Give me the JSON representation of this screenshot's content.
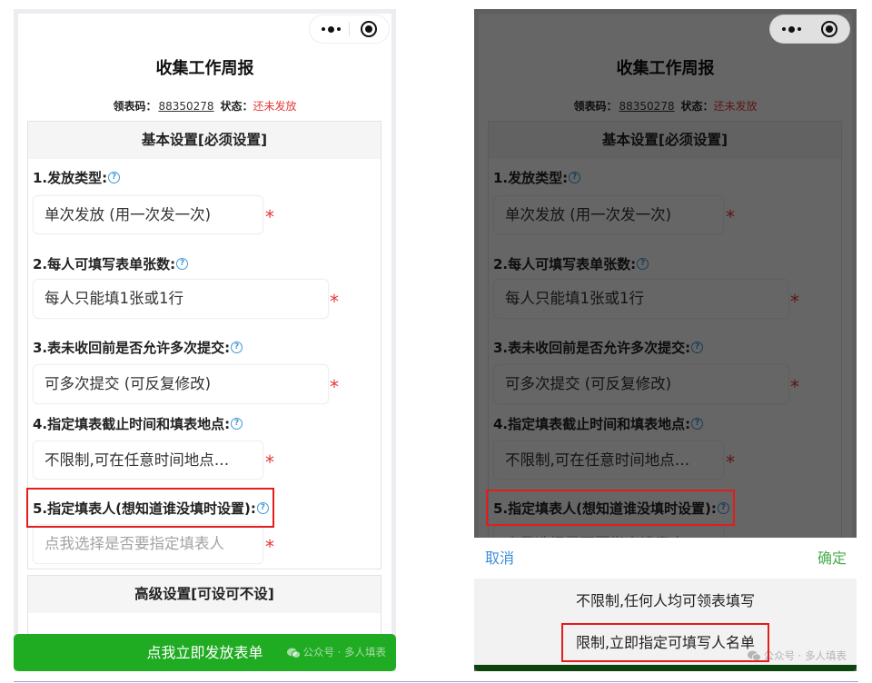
{
  "capsule": {
    "icons": [
      "more-dots-icon",
      "target-circle-icon"
    ]
  },
  "page": {
    "title": "收集工作周报",
    "code_label": "领表码：",
    "code_value": "88350278",
    "status_label": "状态：",
    "status_value": "还未发放"
  },
  "basic_settings": {
    "title": "基本设置[必须设置]",
    "required_mark": "*",
    "help_icon": "question-circle-icon",
    "fields": [
      {
        "label": "1.发放类型:",
        "value": "单次发放 (用一次发一次)"
      },
      {
        "label": "2.每人可填写表单张数:",
        "value": "每人只能填1张或1行"
      },
      {
        "label": "3.表未收回前是否允许多次提交:",
        "value": "可多次提交 (可反复修改)"
      },
      {
        "label": "4.指定填表截止时间和填表地点:",
        "value": "不限制,可在任意时间地点…"
      },
      {
        "label": "5.指定填表人(想知道谁没填时设置):",
        "value": "",
        "placeholder": "点我选择是否要指定填表人"
      }
    ]
  },
  "advanced_settings": {
    "title": "高级设置[可设可不设]"
  },
  "submit_button": {
    "label": "点我立即发放表单"
  },
  "watermark": {
    "icon": "wechat-icon",
    "text": "公众号 · 多人填表"
  },
  "picker": {
    "cancel_label": "取消",
    "confirm_label": "确定",
    "options": [
      {
        "label": "不限制,任何人均可领表填写",
        "highlighted": false
      },
      {
        "label": "限制,立即指定可填写人名单",
        "highlighted": true
      }
    ]
  },
  "colors": {
    "primary_green": "#1fab22",
    "required_red": "#e53935",
    "status_red": "#e53935",
    "help_blue": "#3d9ad6",
    "cancel_blue": "#3c8fd9",
    "confirm_green": "#49ad4f",
    "annotation_red": "#e31c1c",
    "overlay": "rgba(0,0,0,0.6)"
  }
}
